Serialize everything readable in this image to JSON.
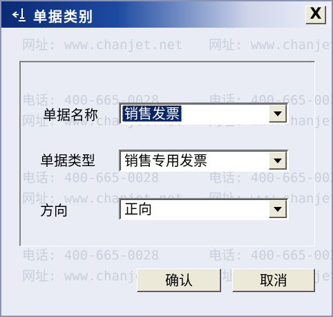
{
  "window": {
    "title": "单据类别",
    "close_symbol": "X"
  },
  "watermarks": [
    "电话: 400-665-0028",
    "网址: www.chanjet.net"
  ],
  "form": {
    "fields": [
      {
        "label": "单据名称",
        "value": "销售发票",
        "selected": true
      },
      {
        "label": "单据类型",
        "value": "销售专用发票",
        "selected": false
      },
      {
        "label": "方向",
        "value": "正向",
        "selected": false
      }
    ]
  },
  "buttons": {
    "ok": "确认",
    "cancel": "取消"
  },
  "icons": {
    "title": "app-icon",
    "dropdown": "chevron-down-icon",
    "close": "close-icon"
  },
  "colors": {
    "title_bar_start": "#0a2a75",
    "selection": "#0a246a"
  }
}
